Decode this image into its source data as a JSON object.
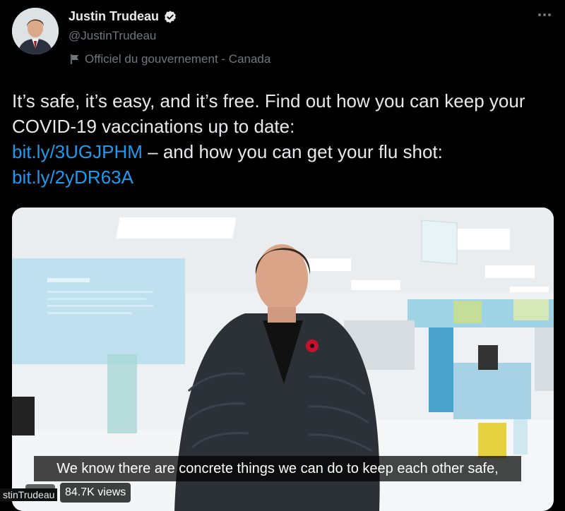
{
  "author": {
    "name": "Justin Trudeau",
    "handle": "@JustinTrudeau",
    "label": "Officiel du gouvernement - Canada"
  },
  "tweet": {
    "text_part1": "It’s safe, it’s easy, and it’s free. Find out how you can keep your COVID-19 vaccinations up to date:",
    "link1": "bit.ly/3UGJPHM",
    "text_part2": "– and how you can get your flu shot:",
    "link2": "bit.ly/2yDR63A"
  },
  "media": {
    "caption": "We know there are concrete things we can do to keep each other safe,",
    "views": "84.7K views",
    "handle_tag": "stinTrudeau"
  },
  "colors": {
    "background": "#000000",
    "text": "#e7e9ea",
    "secondary": "#71767b",
    "link": "#1d9bf0",
    "verified_badge": "#e7e9ea"
  }
}
